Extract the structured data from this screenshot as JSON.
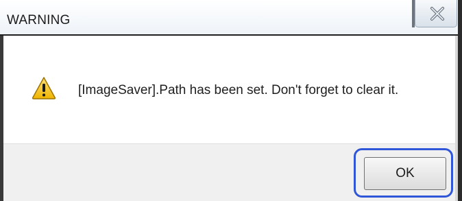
{
  "window": {
    "title": "WARNING",
    "close_icon": "close-icon"
  },
  "message": {
    "icon": "warning-icon",
    "text": "[ImageSaver].Path has been set.  Don't forget to clear it."
  },
  "buttons": {
    "ok_label": "OK"
  },
  "colors": {
    "highlight": "#2f56d8",
    "warning_fill": "#f5c518",
    "button_area": "#f0f0f0"
  }
}
